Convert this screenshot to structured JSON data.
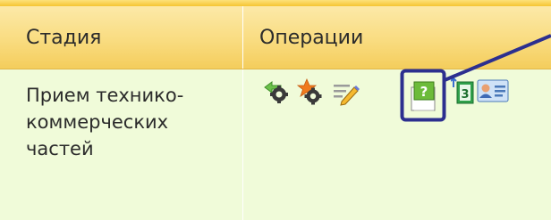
{
  "table": {
    "columns": {
      "stage": "Стадия",
      "operations": "Операции"
    },
    "row": {
      "stage_lines": [
        "Прием технико-",
        "коммерческих",
        "частей"
      ],
      "operation_icons": [
        "gear-green-arrow-icon",
        "gear-star-icon",
        "edit-pen-icon",
        "approve-question-icon",
        "spreadsheet-upload-icon",
        "contact-card-icon"
      ]
    }
  },
  "colors": {
    "header_top": "#fce9a8",
    "header_bottom": "#f4cd5c",
    "row_background": "#f0fbd9",
    "highlight_border": "#2c2f8f"
  }
}
